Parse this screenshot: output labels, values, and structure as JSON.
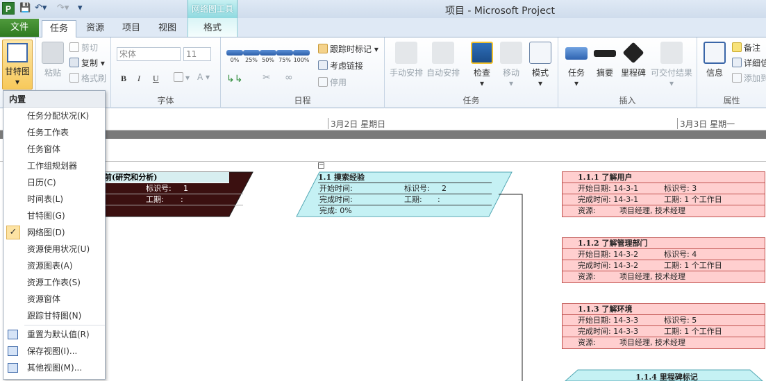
{
  "window": {
    "title": "项目 - Microsoft Project",
    "contextual_group": "网络图工具"
  },
  "tabs": {
    "file": "文件",
    "items": [
      "任务",
      "资源",
      "项目",
      "视图"
    ],
    "contextual": "格式",
    "active": "任务"
  },
  "ribbon": {
    "gantt_button": "甘特图",
    "clipboard": {
      "paste": "粘贴",
      "cut": "剪切",
      "copy": "复制",
      "format_painter": "格式刷"
    },
    "font": {
      "label": "字体",
      "font_name": "宋体",
      "font_size": "11",
      "bold": "B",
      "italic": "I",
      "underline": "U",
      "font_color": "A"
    },
    "schedule": {
      "label": "日程",
      "percents": [
        "0%",
        "25%",
        "50%",
        "75%",
        "100%"
      ],
      "track": "跟踪时标记",
      "respect_links": "考虑链接",
      "inactivate": "停用"
    },
    "tasks": {
      "label": "任务",
      "manual": "手动安排",
      "auto": "自动安排",
      "inspect": "检查",
      "move": "移动",
      "mode": "模式"
    },
    "insert": {
      "label": "插入",
      "task": "任务",
      "summary": "摘要",
      "milestone": "里程碑",
      "deliverable": "可交付结果"
    },
    "properties": {
      "label": "属性",
      "info": "信息",
      "notes": "备注",
      "details": "详细信",
      "add": "添加到"
    }
  },
  "timescale": {
    "day1": "3月2日  星期日",
    "day2": "3月3日  星期一"
  },
  "menu": {
    "header": "内置",
    "items": [
      "任务分配状况(K)",
      "任务工作表",
      "任务窗体",
      "工作组规划器",
      "日历(C)",
      "时间表(L)",
      "甘特图(G)",
      "网络图(D)",
      "资源使用状况(U)",
      "资源图表(A)",
      "资源工作表(S)",
      "资源窗体",
      "跟踪甘特图(N)"
    ],
    "checked": "网络图(D)",
    "actions": [
      "重置为默认值(R)",
      "保存视图(I)...",
      "其他视图(M)..."
    ]
  },
  "nodes": {
    "summary": {
      "title": "前(研究和分析)",
      "id_label": "标识号:",
      "id": "1",
      "duration_label": "工期:",
      "duration": ":"
    },
    "n11": {
      "title": "1.1 摸索经验",
      "start_label": "开始时间:",
      "id_label": "标识号:",
      "id": "2",
      "finish_label": "完成时间:",
      "duration_label": "工期:",
      "duration": ":",
      "complete": "完成: 0%"
    },
    "tasks": [
      {
        "title": "1.1.1 了解用户",
        "start": "开始日期: 14-3-1",
        "id": "标识号:  3",
        "finish": "完成时间: 14-3-1",
        "duration": "工期:   1 个工作日",
        "res_label": "资源:",
        "resources": "项目经理, 技术经理"
      },
      {
        "title": "1.1.2 了解管理部门",
        "start": "开始日期: 14-3-2",
        "id": "标识号:  4",
        "finish": "完成时间: 14-3-2",
        "duration": "工期:   1 个工作日",
        "res_label": "资源:",
        "resources": "项目经理, 技术经理"
      },
      {
        "title": "1.1.3 了解环境",
        "start": "开始日期: 14-3-3",
        "id": "标识号:  5",
        "finish": "完成时间: 14-3-3",
        "duration": "工期:   1 个工作日",
        "res_label": "资源:",
        "resources": "项目经理, 技术经理"
      }
    ],
    "milestone": {
      "title": "1.1.4 里程碑标记"
    }
  },
  "colors": {
    "summary_fill": "#3b1010",
    "task_fill": "#ffcfcf",
    "task_border": "#c0504d",
    "phase_fill": "#c5f1f4",
    "phase_border": "#54a8b4"
  }
}
